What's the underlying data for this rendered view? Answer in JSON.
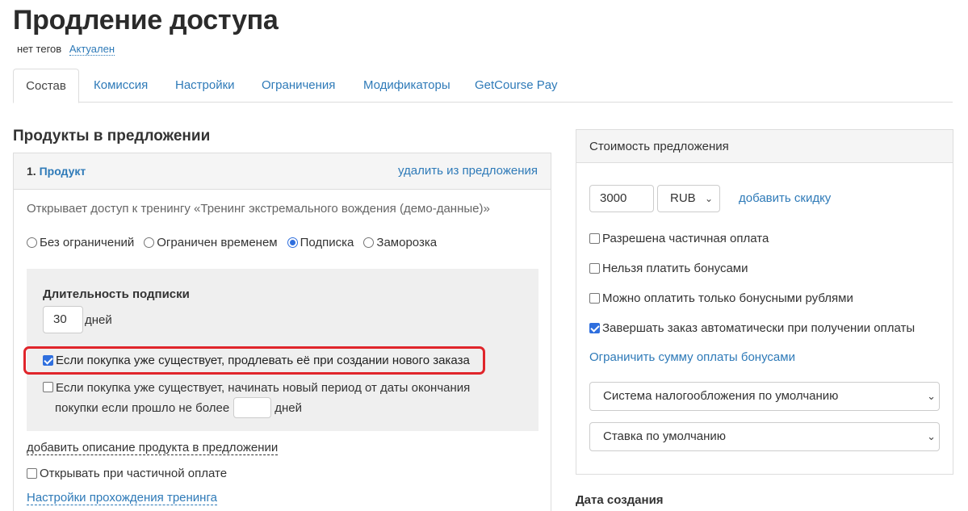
{
  "page": {
    "title": "Продление доступа",
    "no_tags": "нет тегов",
    "status_link": "Актуален"
  },
  "tabs": [
    {
      "label": "Состав",
      "active": true
    },
    {
      "label": "Комиссия"
    },
    {
      "label": "Настройки"
    },
    {
      "label": "Ограничения"
    },
    {
      "label": "Модификаторы"
    },
    {
      "label": "GetCourse Pay"
    }
  ],
  "products": {
    "section_title": "Продукты в предложении",
    "item": {
      "number": "1.",
      "name": "Продукт",
      "remove_label": "удалить из предложения",
      "description": "Открывает доступ к тренингу «Тренинг экстремального вождения (демо-данные)»",
      "access_options": [
        {
          "label": "Без ограничений",
          "checked": false
        },
        {
          "label": "Ограничен временем",
          "checked": false
        },
        {
          "label": "Подписка",
          "checked": true
        },
        {
          "label": "Заморозка",
          "checked": false
        }
      ],
      "subscription": {
        "title": "Длительность подписки",
        "days_value": "30",
        "days_label": "дней",
        "extend_option": {
          "label": "Если покупка уже существует, продлевать её при создании нового заказа",
          "checked": true
        },
        "new_period_option": {
          "label_line1": "Если покупка уже существует, начинать новый период от даты окончания",
          "label_line2": "покупки если прошло не более",
          "value": "",
          "days_label": "дней",
          "checked": false
        }
      },
      "add_description_label": "добавить описание продукта в предложении",
      "partial_payment_open": {
        "label": "Открывать при частичной оплате",
        "checked": false
      },
      "training_settings_label": "Настройки прохождения тренинга"
    }
  },
  "cost": {
    "title": "Стоимость предложения",
    "price": "3000",
    "currency": "RUB",
    "add_discount_label": "добавить скидку",
    "options": [
      {
        "label": "Разрешена частичная оплата",
        "checked": false
      },
      {
        "label": "Нельзя платить бонусами",
        "checked": false
      },
      {
        "label": "Можно оплатить только бонусными рублями",
        "checked": false
      },
      {
        "label": "Завершать заказ автоматически при получении оплаты",
        "checked": true
      }
    ],
    "limit_bonus_label": "Ограничить сумму оплаты бонусами",
    "tax_system": "Система налогообложения по умолчанию",
    "tax_rate": "Ставка по умолчанию"
  },
  "created": {
    "title": "Дата создания"
  },
  "colors": {
    "link": "#2e7ab8",
    "highlight": "#e0252b",
    "checkbox_checked": "#2f6fde"
  }
}
